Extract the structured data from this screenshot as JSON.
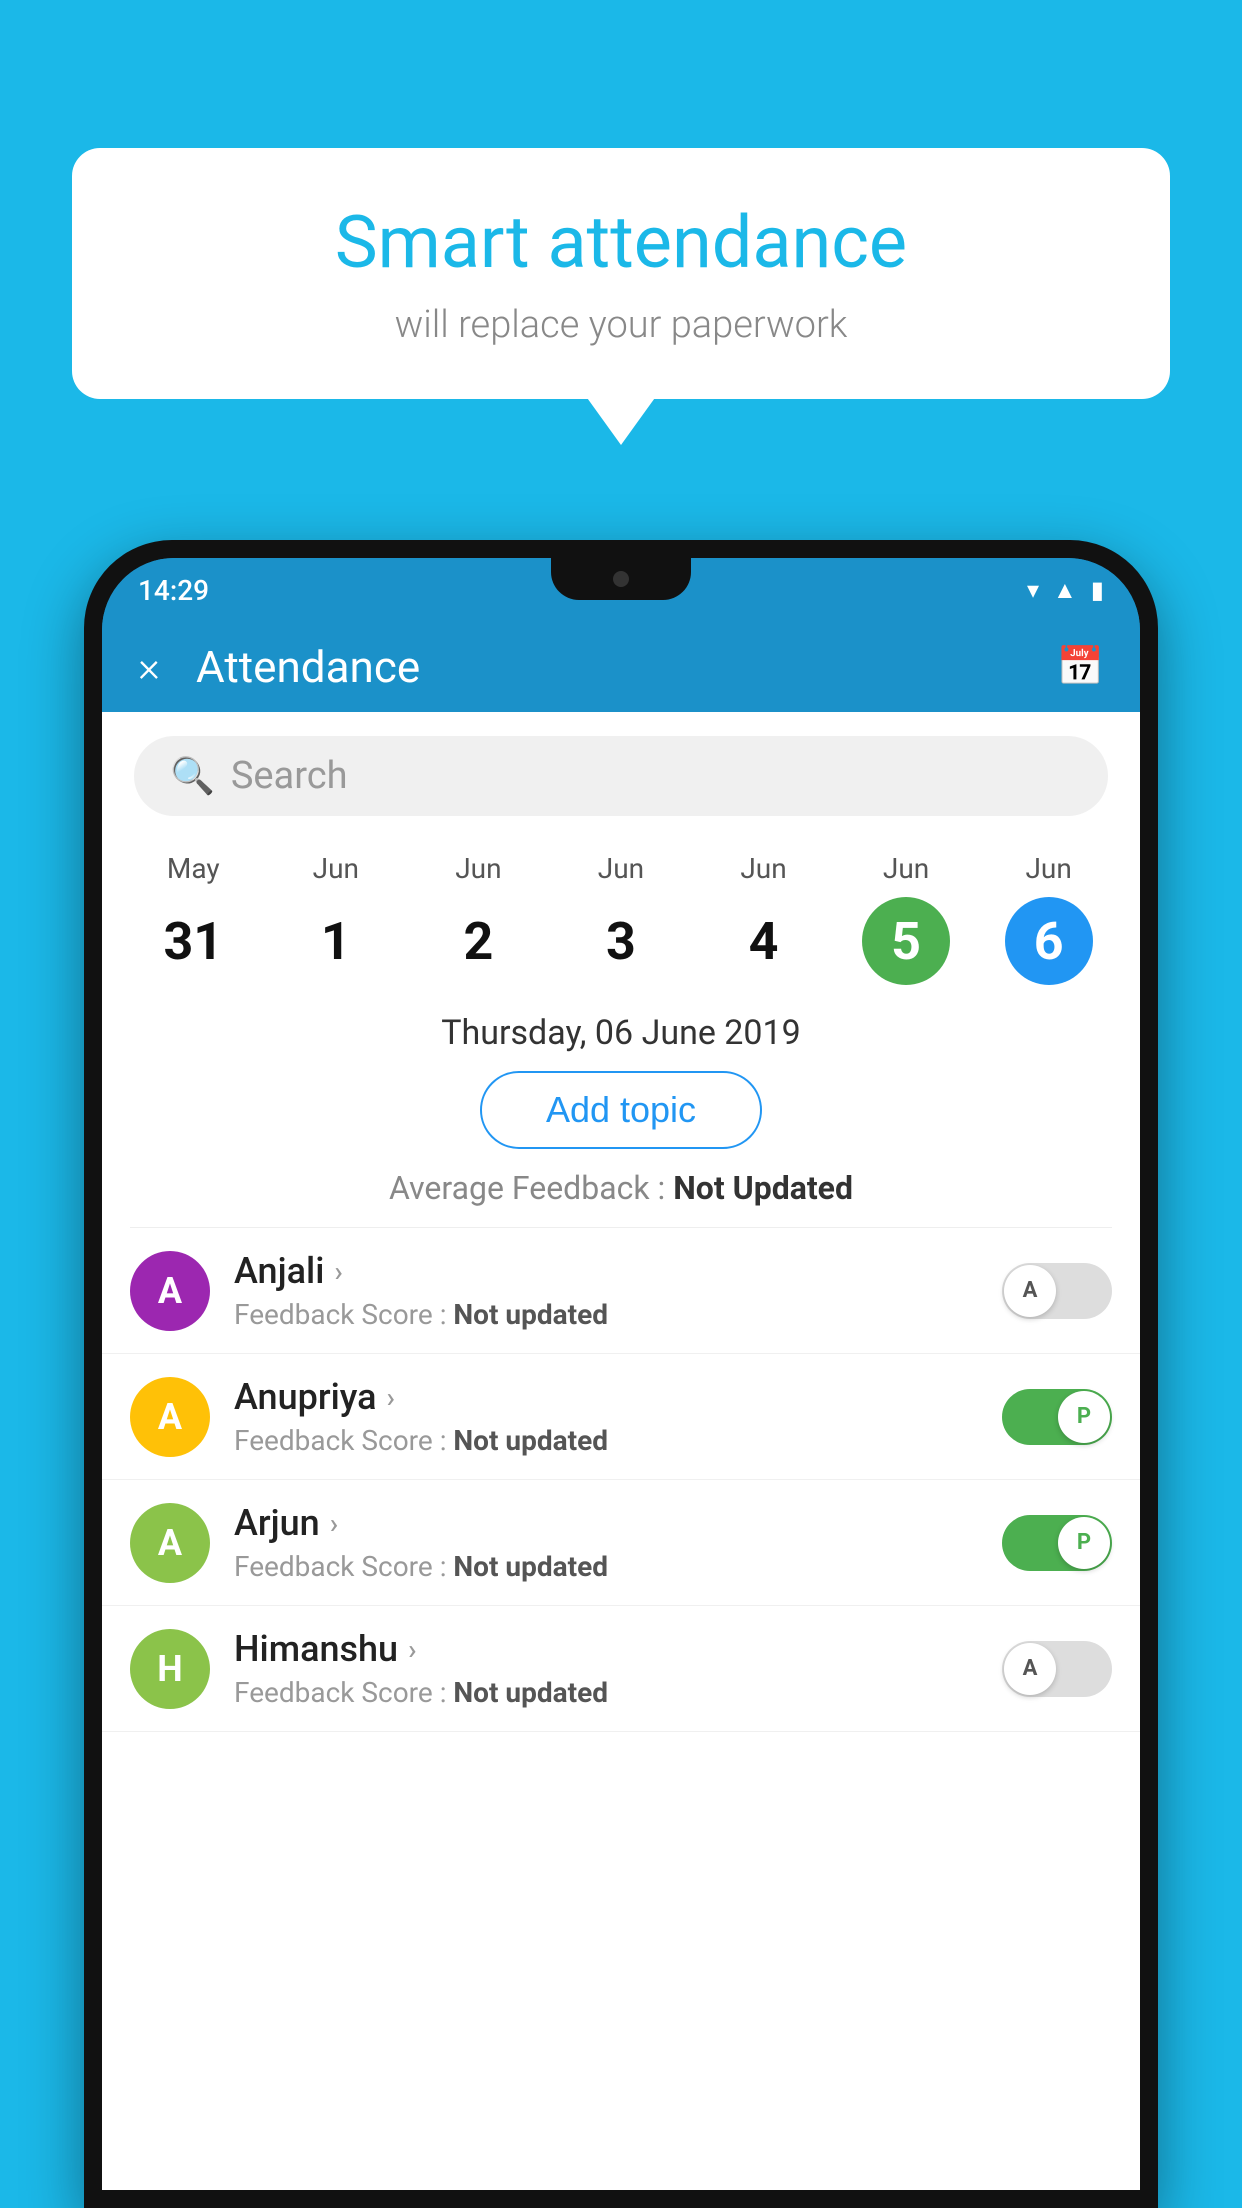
{
  "background_color": "#1BB8E8",
  "bubble": {
    "title": "Smart attendance",
    "subtitle": "will replace your paperwork"
  },
  "status_bar": {
    "time": "14:29",
    "icons": [
      "wifi",
      "signal",
      "battery"
    ]
  },
  "header": {
    "title": "Attendance",
    "close_label": "×",
    "calendar_icon": "📅"
  },
  "search": {
    "placeholder": "Search"
  },
  "calendar": {
    "days": [
      {
        "month": "May",
        "date": "31",
        "highlight": ""
      },
      {
        "month": "Jun",
        "date": "1",
        "highlight": ""
      },
      {
        "month": "Jun",
        "date": "2",
        "highlight": ""
      },
      {
        "month": "Jun",
        "date": "3",
        "highlight": ""
      },
      {
        "month": "Jun",
        "date": "4",
        "highlight": ""
      },
      {
        "month": "Jun",
        "date": "5",
        "highlight": "green"
      },
      {
        "month": "Jun",
        "date": "6",
        "highlight": "blue"
      }
    ],
    "selected_date": "Thursday, 06 June 2019"
  },
  "add_topic_label": "Add topic",
  "avg_feedback_label": "Average Feedback : ",
  "avg_feedback_value": "Not Updated",
  "students": [
    {
      "name": "Anjali",
      "avatar_letter": "A",
      "avatar_color": "#9C27B0",
      "feedback": "Not updated",
      "toggle_state": "off",
      "toggle_label": "A"
    },
    {
      "name": "Anupriya",
      "avatar_letter": "A",
      "avatar_color": "#FFC107",
      "feedback": "Not updated",
      "toggle_state": "on",
      "toggle_label": "P"
    },
    {
      "name": "Arjun",
      "avatar_letter": "A",
      "avatar_color": "#8BC34A",
      "feedback": "Not updated",
      "toggle_state": "on",
      "toggle_label": "P"
    },
    {
      "name": "Himanshu",
      "avatar_letter": "H",
      "avatar_color": "#8BC34A",
      "feedback": "Not updated",
      "toggle_state": "off",
      "toggle_label": "A"
    }
  ],
  "feedback_score_prefix": "Feedback Score : "
}
